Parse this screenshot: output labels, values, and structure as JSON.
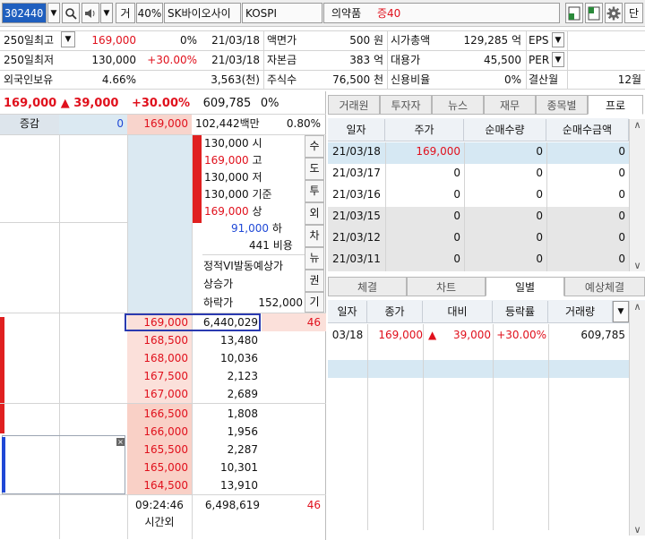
{
  "toolbar": {
    "code": "302440",
    "ge_label": "거",
    "pct_label": "40%",
    "stock_name": "SK바이오사이",
    "market": "KOSPI",
    "sector": "의약품",
    "margin": "증40",
    "dan_label": "단"
  },
  "info": {
    "r1": {
      "label": "250일최고",
      "price": "169,000",
      "pct": "0%",
      "date": "21/03/18",
      "k1": "액면가",
      "v1": "500 원",
      "k2": "시가총액",
      "v2": "129,285 억",
      "k3": "EPS"
    },
    "r2": {
      "label": "250일최저",
      "price": "130,000",
      "pct": "+30.00%",
      "date": "21/03/18",
      "k1": "자본금",
      "v1": "383 억",
      "k2": "대용가",
      "v2": "45,500",
      "k3": "PER"
    },
    "r3": {
      "label": "외국인보유",
      "price": "4.66%",
      "extra": "3,563(천)",
      "k1": "주식수",
      "v1": "76,500 천",
      "k2": "신용비율",
      "v2": "0%",
      "k3": "결산월",
      "v3": "12월"
    }
  },
  "quote": {
    "price": "169,000",
    "change": "39,000",
    "pct": "+30.00%",
    "volume": "609,785",
    "vol_pct": "0%",
    "inc_label": "증감",
    "inc_val": "0",
    "cur": "169,000",
    "amount": "102,442백만",
    "ratio": "0.80%"
  },
  "summary": [
    {
      "value": "130,000",
      "label": "시",
      "color": "#111"
    },
    {
      "value": "169,000",
      "label": "고",
      "color": "#e0101c"
    },
    {
      "value": "130,000",
      "label": "저",
      "color": "#111"
    },
    {
      "value": "130,000",
      "label": "기준",
      "color": "#111"
    },
    {
      "value": "169,000",
      "label": "상",
      "color": "#e0101c"
    },
    {
      "value": "91,000",
      "label": "하",
      "color": "#1f48d6"
    },
    {
      "value": "441",
      "label": "비용",
      "color": "#111"
    }
  ],
  "vi": {
    "title": "정적VI발동예상가",
    "up": "상승가",
    "down": "하락가",
    "down_val": "152,000"
  },
  "side_buttons": [
    "수",
    "도",
    "투",
    "외",
    "차",
    "뉴",
    "권",
    "기"
  ],
  "asks": [
    {
      "price": "169,000",
      "qty": "6,440,029",
      "extra": "46"
    },
    {
      "price": "168,500",
      "qty": "13,480"
    },
    {
      "price": "168,000",
      "qty": "10,036"
    },
    {
      "price": "167,500",
      "qty": "2,123"
    },
    {
      "price": "167,000",
      "qty": "2,689"
    }
  ],
  "bids": [
    {
      "price": "166,500",
      "qty": "1,808"
    },
    {
      "price": "166,000",
      "qty": "1,956"
    },
    {
      "price": "165,500",
      "qty": "2,287"
    },
    {
      "price": "165,000",
      "qty": "10,301"
    },
    {
      "price": "164,500",
      "qty": "13,910"
    }
  ],
  "footer": {
    "time": "09:24:46",
    "time_label": "시간외",
    "total": "6,498,619",
    "extra": "46"
  },
  "upper_tabs": [
    "거래원",
    "투자자",
    "뉴스",
    "재무",
    "종목별",
    "프로"
  ],
  "upper_table": {
    "headers": [
      "일자",
      "주가",
      "순매수량",
      "순매수금액"
    ],
    "rows": [
      [
        "21/03/18",
        "169,000",
        "0",
        "0"
      ],
      [
        "21/03/17",
        "0",
        "0",
        "0"
      ],
      [
        "21/03/16",
        "0",
        "0",
        "0"
      ],
      [
        "21/03/15",
        "0",
        "0",
        "0"
      ],
      [
        "21/03/12",
        "0",
        "0",
        "0"
      ],
      [
        "21/03/11",
        "0",
        "0",
        "0"
      ]
    ]
  },
  "lower_tabs": [
    "체결",
    "차트",
    "일별",
    "예상체결"
  ],
  "lower_table": {
    "headers": [
      "일자",
      "종가",
      "대비",
      "등락률",
      "거래량"
    ],
    "row": [
      "03/18",
      "169,000",
      "39,000",
      "+30.00%",
      "609,785"
    ]
  }
}
